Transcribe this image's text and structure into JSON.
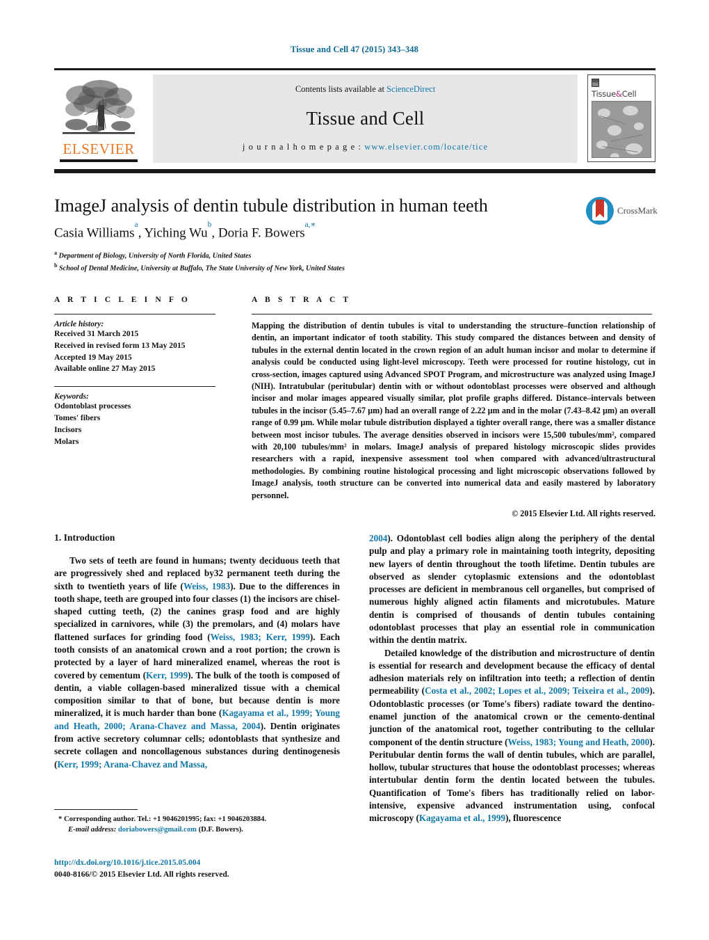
{
  "running_head": "Tissue and Cell 47 (2015) 343–348",
  "masthead": {
    "publisher_logo_word": "ELSEVIER",
    "contents_prefix": "Contents lists available at ",
    "contents_link": "ScienceDirect",
    "journal_title": "Tissue and Cell",
    "homepage_prefix": "j o u r n a l   h o m e p a g e :   ",
    "homepage_url": "www.elsevier.com/locate/tice",
    "cover_title_left": "Tissue",
    "cover_title_amp": "&",
    "cover_title_right": "Cell"
  },
  "article": {
    "title": "ImageJ analysis of dentin tubule distribution in human teeth",
    "authors_html": "Casia Williams, Yiching Wu, Doria F. Bowers",
    "affiliation_a": "Department of Biology, University of North Florida, United States",
    "affiliation_b": "School of Dental Medicine, University at Buffalo, The State University of New York, United States",
    "crossmark_label": "CrossMark"
  },
  "info": {
    "heading": "A R T I C L E   I N F O",
    "history_label": "Article history:",
    "history": [
      "Received 31 March 2015",
      "Received in revised form 13 May 2015",
      "Accepted 19 May 2015",
      "Available online 27 May 2015"
    ],
    "keywords_label": "Keywords:",
    "keywords": [
      "Odontoblast processes",
      "Tomes' fibers",
      "Incisors",
      "Molars"
    ]
  },
  "abstract": {
    "heading": "A B S T R A C T",
    "text": "Mapping the distribution of dentin tubules is vital to understanding the structure–function relationship of dentin, an important indicator of tooth stability. This study compared the distances between and density of tubules in the external dentin located in the crown region of an adult human incisor and molar to determine if analysis could be conducted using light-level microscopy. Teeth were processed for routine histology, cut in cross-section, images captured using Advanced SPOT Program, and microstructure was analyzed using ImageJ (NIH). Intratubular (peritubular) dentin with or without odontoblast processes were observed and although incisor and molar images appeared visually similar, plot profile graphs differed. Distance–intervals between tubules in the incisor (5.45–7.67 μm) had an overall range of 2.22 μm and in the molar (7.43–8.42 μm) an overall range of 0.99 μm. While molar tubule distribution displayed a tighter overall range, there was a smaller distance between most incisor tubules. The average densities observed in incisors were 15,500 tubules/mm², compared with 20,100 tubules/mm² in molars. ImageJ analysis of prepared histology microscopic slides provides researchers with a rapid, inexpensive assessment tool when compared with advanced/ultrastructural methodologies. By combining routine histological processing and light microscopic observations followed by ImageJ analysis, tooth structure can be converted into numerical data and easily mastered by laboratory personnel.",
    "copyright": "© 2015 Elsevier Ltd. All rights reserved."
  },
  "intro": {
    "heading": "1.  Introduction",
    "left_paragraph_1_html": "Two sets of teeth are found in humans; twenty deciduous teeth that are progressively shed and replaced by32 permanent teeth during the sixth to twentieth years of life (<span class=\"cite\">Weiss, 1983</span>). Due to the differences in tooth shape, teeth are grouped into four classes (1) the incisors are chisel-shaped cutting teeth, (2) the canines grasp food and are highly specialized in carnivores, while (3) the premolars, and (4) molars have flattened surfaces for grinding food (<span class=\"cite\">Weiss, 1983; Kerr, 1999</span>). Each tooth consists of an anatomical crown and a root portion; the crown is protected by a layer of hard mineralized enamel, whereas the root is covered by cementum (<span class=\"cite\">Kerr, 1999</span>). The bulk of the tooth is composed of dentin, a viable collagen-based mineralized tissue with a chemical composition similar to that of bone, but because dentin is more mineralized, it is much harder than bone (<span class=\"cite\">Kagayama et al., 1999; Young and Heath, 2000; Arana-Chavez and Massa, 2004</span>). Dentin originates from active secretory columnar cells; odontoblasts that synthesize and secrete collagen and noncollagenous substances during dentinogenesis (<span class=\"cite\">Kerr, 1999; Arana-Chavez and Massa,</span>",
    "right_paragraph_1_html": "<span class=\"cite\">2004</span>). Odontoblast cell bodies align along the periphery of the dental pulp and play a primary role in maintaining tooth integrity, depositing new layers of dentin throughout the tooth lifetime. Dentin tubules are observed as slender cytoplasmic extensions and the odontoblast processes are deficient in membranous cell organelles, but comprised of numerous highly aligned actin filaments and microtubules. Mature dentin is comprised of thousands of dentin tubules containing odontoblast processes that play an essential role in communication within the dentin matrix.",
    "right_paragraph_2_html": "Detailed knowledge of the distribution and microstructure of dentin is essential for research and development because the efficacy of dental adhesion materials rely on infiltration into teeth; a reflection of dentin permeability (<span class=\"cite\">Costa et al., 2002; Lopes et al., 2009; Teixeira et al., 2009</span>). Odontoblastic processes (or Tome's fibers) radiate toward the dentino-enamel junction of the anatomical crown or the cemento-dentinal junction of the anatomical root, together contributing to the cellular component of the dentin structure (<span class=\"cite\">Weiss, 1983; Young and Heath, 2000</span>). Peritubular dentin forms the wall of dentin tubules, which are parallel, hollow, tubular structures that house the odontoblast processes; whereas intertubular dentin form the dentin located between the tubules. Quantification of Tome's fibers has traditionally relied on labor-intensive, expensive advanced instrumentation using, confocal microscopy (<span class=\"cite\">Kagayama et al., 1999</span>), fluorescence"
  },
  "footer": {
    "corresponding_marker": "*",
    "corresponding_text": "Corresponding author. Tel.: +1 9046201995; fax: +1 9046203884.",
    "email_label": "E-mail address:",
    "email": "doriabowers@gmail.com",
    "email_suffix": "(D.F. Bowers).",
    "doi": "http://dx.doi.org/10.1016/j.tice.2015.05.004",
    "issn_line": "0040-8166/© 2015 Elsevier Ltd. All rights reserved."
  },
  "colors": {
    "link": "#1178a8",
    "elsevier_orange": "#e87722",
    "crossmark_blue": "#1f8fc4",
    "crossmark_red": "#c8352a"
  }
}
